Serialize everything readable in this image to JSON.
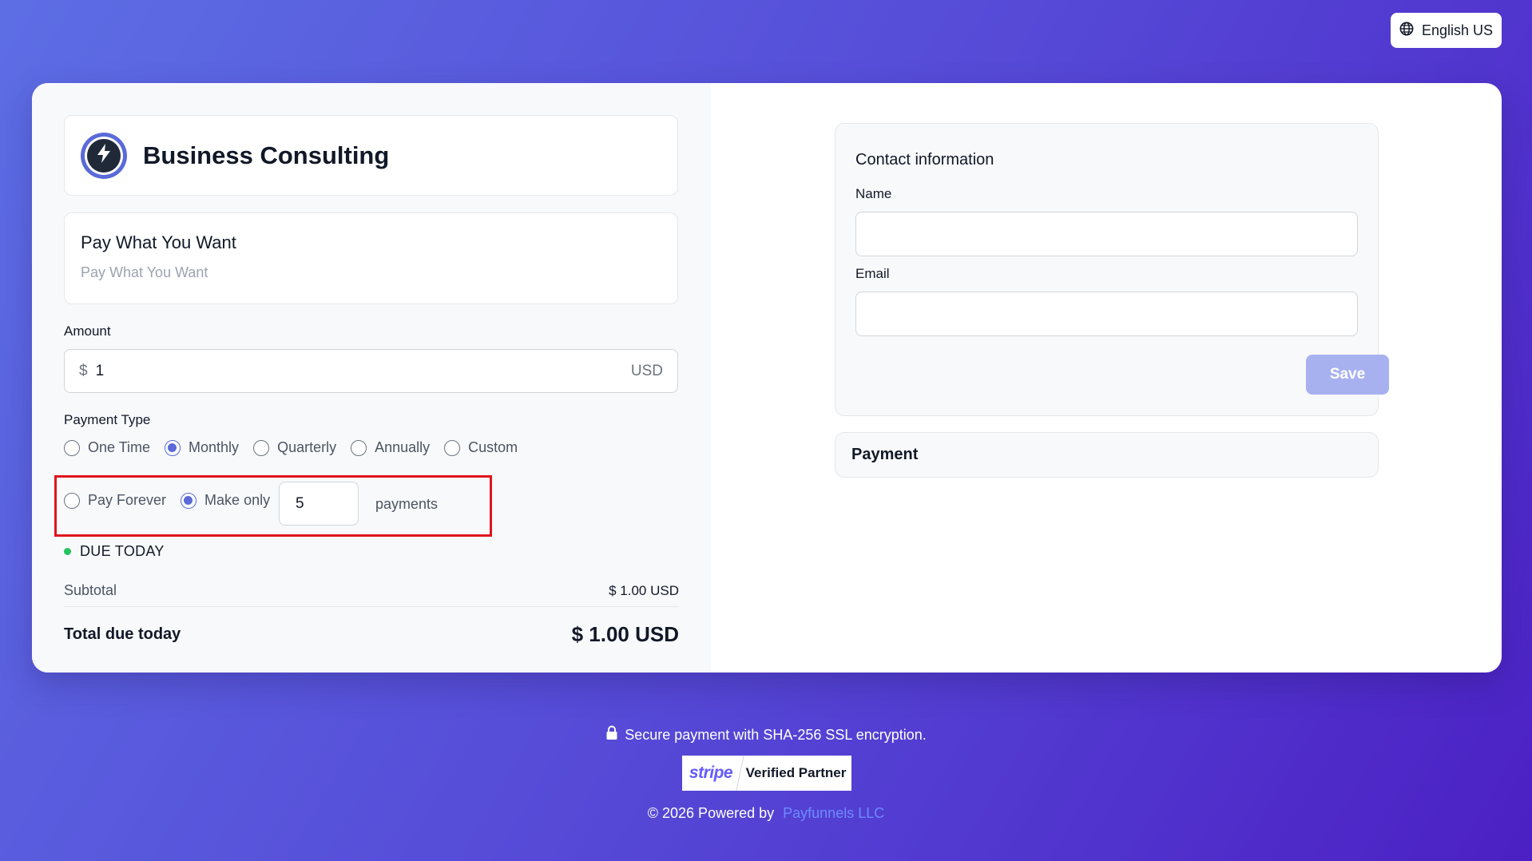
{
  "header": {
    "language_label": "English US",
    "language_icon": "globe-icon"
  },
  "product": {
    "title": "Business Consulting",
    "logo_icon": "lightning-bolt-icon"
  },
  "plan": {
    "title": "Pay What You Want",
    "subtitle": "Pay What You Want"
  },
  "amount": {
    "label": "Amount",
    "currency_symbol": "$",
    "value": "1",
    "currency_code": "USD"
  },
  "payment_type": {
    "label": "Payment Type",
    "options": [
      {
        "label": "One Time",
        "checked": false
      },
      {
        "label": "Monthly",
        "checked": true
      },
      {
        "label": "Quarterly",
        "checked": false
      },
      {
        "label": "Annually",
        "checked": false
      },
      {
        "label": "Custom",
        "checked": false
      }
    ]
  },
  "duration": {
    "options": [
      {
        "label": "Pay Forever",
        "checked": false
      },
      {
        "label": "Make only",
        "checked": true
      }
    ],
    "payments_count": "5",
    "payments_label": "payments"
  },
  "summary": {
    "due_today_label": "DUE TODAY",
    "subtotal_label": "Subtotal",
    "subtotal_value": "$ 1.00 USD",
    "total_label": "Total due today",
    "total_value": "$ 1.00 USD"
  },
  "contact": {
    "title": "Contact information",
    "name_label": "Name",
    "name_value": "",
    "email_label": "Email",
    "email_value": "",
    "save_label": "Save"
  },
  "payment_section": {
    "title": "Payment"
  },
  "footer": {
    "secure_text": "Secure payment with SHA-256 SSL encryption.",
    "lock_icon": "lock-icon",
    "stripe_word": "stripe",
    "stripe_partner": "Verified Partner",
    "powered_prefix": "© 2026 Powered by",
    "powered_link": "Payfunnels LLC"
  },
  "colors": {
    "accent": "#5b6ad8",
    "highlight": "#e0151b",
    "status_green": "#22c55e",
    "save_button": "#a8b1f0"
  }
}
